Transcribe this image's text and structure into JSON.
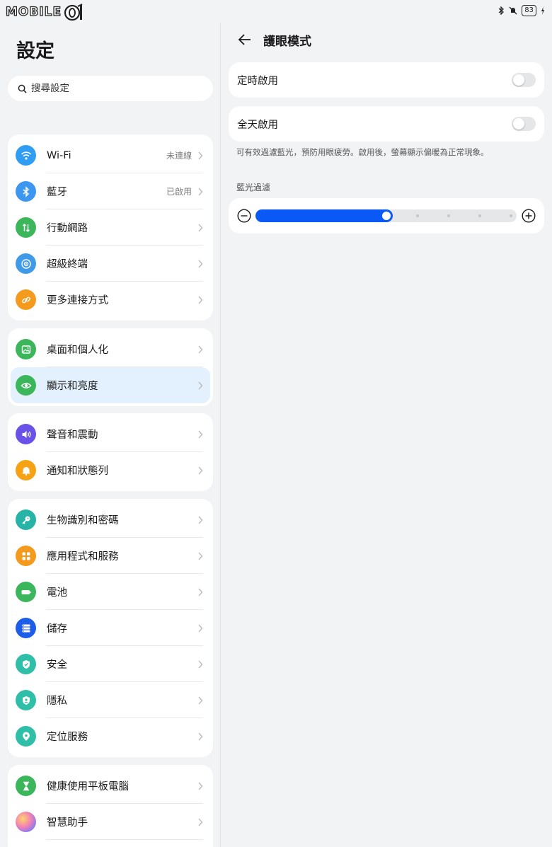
{
  "status": {
    "logo_text": "MOBILE",
    "logo_mark": "01",
    "battery": "83"
  },
  "left": {
    "title": "設定",
    "search": {
      "placeholder": "搜尋設定"
    },
    "groups": [
      [
        {
          "label": "Wi-Fi",
          "value": "未連線",
          "icon": "wifi-icon",
          "color": "#2f9df1"
        },
        {
          "label": "藍牙",
          "value": "已啟用",
          "icon": "bluetooth-icon",
          "color": "#3d96f0"
        },
        {
          "label": "行動網路",
          "value": "",
          "icon": "mobile-data-icon",
          "color": "#3bb65a"
        },
        {
          "label": "超級終端",
          "value": "",
          "icon": "super-device-icon",
          "color": "#3f9be8"
        },
        {
          "label": "更多連接方式",
          "value": "",
          "icon": "link-icon",
          "color": "#f49a1c"
        }
      ],
      [
        {
          "label": "桌面和個人化",
          "value": "",
          "icon": "wallpaper-icon",
          "color": "#3bb65a"
        },
        {
          "label": "顯示和亮度",
          "value": "",
          "icon": "eye-icon",
          "color": "#3bb65a"
        }
      ],
      [
        {
          "label": "聲音和震動",
          "value": "",
          "icon": "speaker-icon",
          "color": "#6a52e8"
        },
        {
          "label": "通知和狀態列",
          "value": "",
          "icon": "bell-icon",
          "color": "#f5a214"
        }
      ],
      [
        {
          "label": "生物識別和密碼",
          "value": "",
          "icon": "key-icon",
          "color": "#27b4a6"
        },
        {
          "label": "應用程式和服務",
          "value": "",
          "icon": "apps-icon",
          "color": "#f49a1c"
        },
        {
          "label": "電池",
          "value": "",
          "icon": "battery-icon",
          "color": "#3bb65a"
        },
        {
          "label": "儲存",
          "value": "",
          "icon": "storage-icon",
          "color": "#1d5ee8"
        },
        {
          "label": "安全",
          "value": "",
          "icon": "shield-icon",
          "color": "#2fbfa8"
        },
        {
          "label": "隱私",
          "value": "",
          "icon": "privacy-icon",
          "color": "#2fbfa8"
        },
        {
          "label": "定位服務",
          "value": "",
          "icon": "location-icon",
          "color": "#2fbfa8"
        }
      ],
      [
        {
          "label": "健康使用平板電腦",
          "value": "",
          "icon": "hourglass-icon",
          "color": "#3bb65a"
        },
        {
          "label": "智慧助手",
          "value": "",
          "icon": "assistant-icon",
          "color": "#e98bc6"
        }
      ]
    ]
  },
  "right": {
    "title": "護眼模式",
    "scheduled_label": "定時啟用",
    "scheduled_on": false,
    "allday_label": "全天啟用",
    "allday_on": false,
    "description": "可有效過濾藍光，預防用眼疲勞。啟用後，螢幕顯示偏暖為正常現象。",
    "filter_label": "藍光過濾",
    "filter_level": 0.5,
    "accent": "#0a59f7"
  }
}
